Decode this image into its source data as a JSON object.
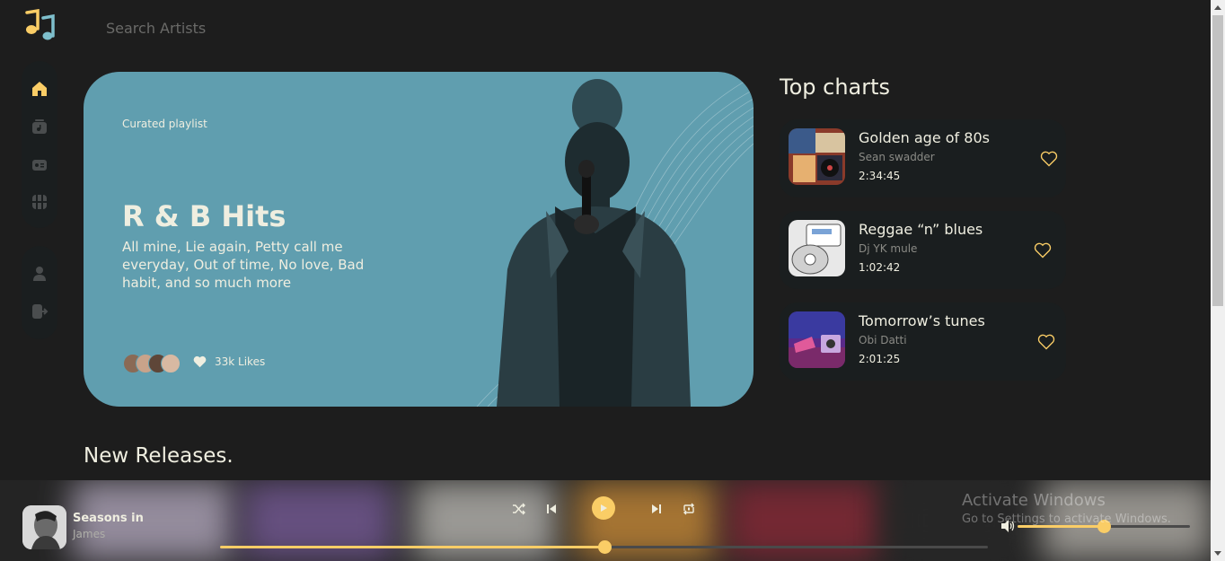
{
  "header": {
    "logo_icon": "music-notes-icon",
    "search_placeholder": "Search Artists"
  },
  "sidebar": {
    "main_items": [
      {
        "icon": "home-icon",
        "active": true
      },
      {
        "icon": "playlist-icon"
      },
      {
        "icon": "radio-icon"
      },
      {
        "icon": "video-icon"
      }
    ],
    "secondary_items": [
      {
        "icon": "profile-icon"
      },
      {
        "icon": "logout-icon"
      }
    ]
  },
  "hero": {
    "kicker": "Curated playlist",
    "title": "R & B Hits",
    "description": "All mine, Lie again, Petty call me everyday, Out of time, No love, Bad habit, and so much more",
    "likes": "33k Likes",
    "bg_color": "#609eaf"
  },
  "top_charts": {
    "title": "Top charts",
    "items": [
      {
        "name": "Golden age of 80s",
        "artist": "Sean swadder",
        "duration": "2:34:45"
      },
      {
        "name": "Reggae “n” blues",
        "artist": "Dj YK mule",
        "duration": "1:02:42"
      },
      {
        "name": "Tomorrow’s tunes",
        "artist": "Obi Datti",
        "duration": "2:01:25"
      }
    ]
  },
  "new_releases": {
    "title": "New Releases."
  },
  "player": {
    "track_title": "Seasons in",
    "track_artist": "James",
    "progress": 0.5,
    "volume": 0.5
  },
  "watermark": {
    "line1": "Activate Windows",
    "line2": "Go to Settings to activate Windows."
  },
  "colors": {
    "accent": "#facd66",
    "background": "#1d1d1d",
    "card": "#1a1e1f",
    "text": "#efeee0"
  }
}
